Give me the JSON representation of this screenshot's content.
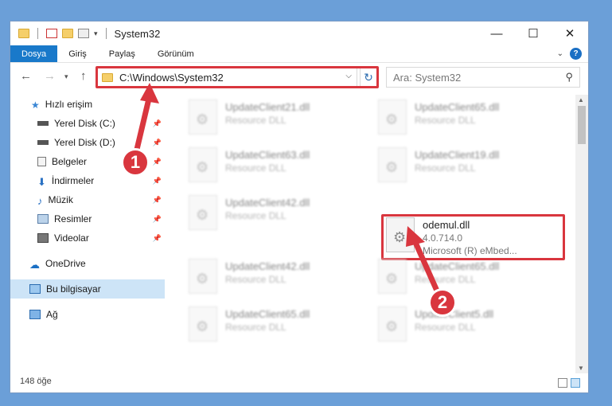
{
  "window": {
    "title": "System32",
    "controls": {
      "minimize": "—",
      "maximize": "☐",
      "close": "✕"
    }
  },
  "ribbon": {
    "tabs": [
      {
        "label": "Dosya"
      },
      {
        "label": "Giriş"
      },
      {
        "label": "Paylaş"
      },
      {
        "label": "Görünüm"
      }
    ],
    "help": "?"
  },
  "address": {
    "path": "C:\\Windows\\System32",
    "search_placeholder": "Ara: System32"
  },
  "sidebar": {
    "items": [
      {
        "label": "Hızlı erişim",
        "icon": "star-icon"
      },
      {
        "label": "Yerel Disk (C:)",
        "icon": "drive-icon",
        "pinned": true
      },
      {
        "label": "Yerel Disk (D:)",
        "icon": "drive-icon",
        "pinned": true
      },
      {
        "label": "Belgeler",
        "icon": "documents-icon",
        "pinned": true
      },
      {
        "label": "İndirmeler",
        "icon": "download-icon",
        "pinned": true
      },
      {
        "label": "Müzik",
        "icon": "music-icon",
        "pinned": true
      },
      {
        "label": "Resimler",
        "icon": "pictures-icon",
        "pinned": true
      },
      {
        "label": "Videolar",
        "icon": "videos-icon",
        "pinned": true
      },
      {
        "label": "OneDrive",
        "icon": "cloud-icon"
      },
      {
        "label": "Bu bilgisayar",
        "icon": "computer-icon",
        "selected": true
      },
      {
        "label": "Ağ",
        "icon": "network-icon"
      }
    ]
  },
  "files": [
    {
      "name": "UpdateClient21.dll",
      "desc": "Resource DLL"
    },
    {
      "name": "UpdateClient65.dll",
      "desc": "Resource DLL"
    },
    {
      "name": "UpdateClient63.dll",
      "desc": "Resource DLL"
    },
    {
      "name": "UpdateClient19.dll",
      "desc": "Resource DLL"
    },
    {
      "name": "UpdateClient42.dll",
      "desc": "Resource DLL"
    },
    {
      "name": "odemul.dll",
      "version": "4.0.714.0",
      "desc": "Microsoft (R) eMbed..."
    },
    {
      "name": "UpdateClient42.dll",
      "desc": "Resource DLL"
    },
    {
      "name": "UpdateClient65.dll",
      "desc": "Resource DLL"
    },
    {
      "name": "UpdateClient65.dll",
      "desc": "Resource DLL"
    },
    {
      "name": "UpdateClient5.dll",
      "desc": "Resource DLL"
    }
  ],
  "status": {
    "count": "148 öğe"
  },
  "callouts": {
    "one": "1",
    "two": "2"
  },
  "colors": {
    "accent": "#1979ca",
    "highlight": "#d9363e",
    "selection": "#cde4f7"
  }
}
